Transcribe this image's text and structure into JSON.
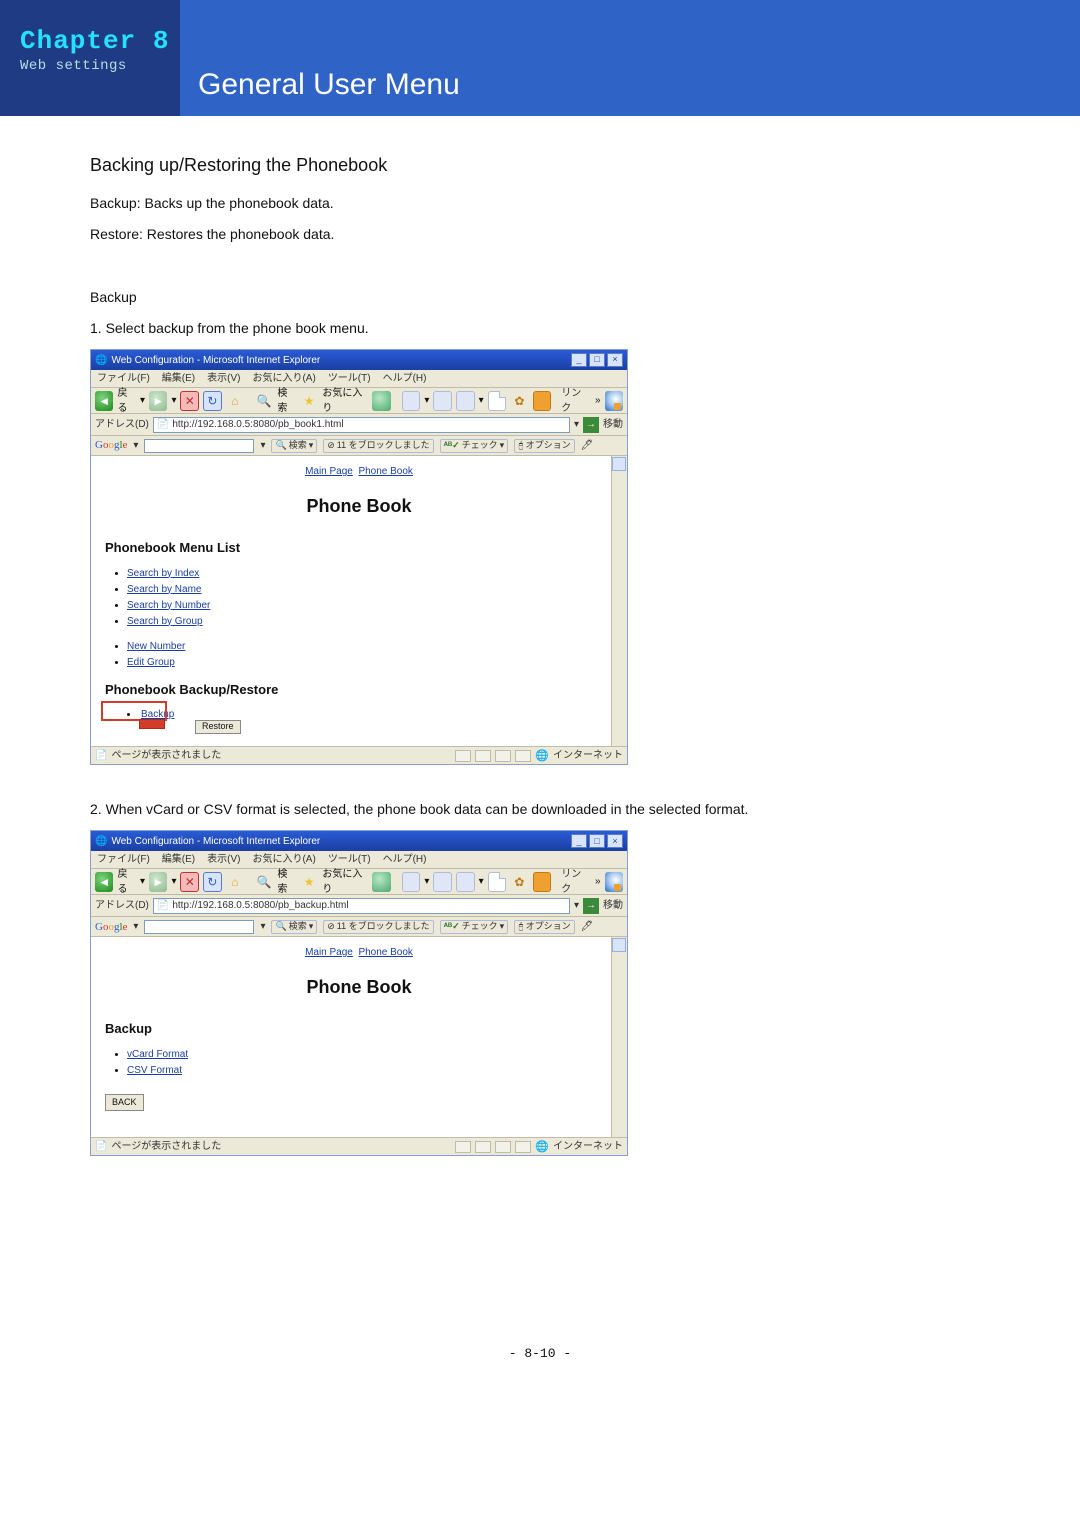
{
  "header": {
    "chapter": "Chapter 8",
    "subtitle": "Web settings",
    "title": "General User Menu"
  },
  "section": {
    "heading": "Backing up/Restoring the Phonebook",
    "line1": "Backup: Backs up the phonebook data.",
    "line2": "Restore: Restores the phonebook data."
  },
  "backup": {
    "label": "Backup",
    "step1": "1. Select backup from the phone book menu.",
    "step2": "2. When vCard or CSV format is selected, the phone book data can be downloaded in the selected format."
  },
  "ie": {
    "window_title": "Web Configuration - Microsoft Internet Explorer",
    "menus": [
      "ファイル(F)",
      "編集(E)",
      "表示(V)",
      "お気に入り(A)",
      "ツール(T)",
      "ヘルプ(H)"
    ],
    "toolbar": {
      "back": "戻る",
      "search": "検索",
      "favorites": "お気に入り",
      "links": "リンク"
    },
    "address_label": "アドレス(D)",
    "address1": "http://192.168.0.5:8080/pb_book1.html",
    "address2": "http://192.168.0.5:8080/pb_backup.html",
    "go": "移動",
    "googlebar": {
      "logo": "Google",
      "search_btn": "検索",
      "blocked": "11 をブロックしました",
      "check": "チェック",
      "options": "オプション"
    },
    "status_done": "ページが表示されました",
    "status_zone": "インターネット"
  },
  "page1": {
    "crumb_main": "Main Page",
    "crumb_phone": "Phone Book",
    "title": "Phone Book",
    "menu_list": "Phonebook Menu List",
    "items1": [
      "Search by Index",
      "Search by Name",
      "Search by Number",
      "Search by Group"
    ],
    "items2": [
      "New Number",
      "Edit Group"
    ],
    "backup_restore": "Phonebook Backup/Restore",
    "backup_link": "Backup",
    "restore_btn": "Restore"
  },
  "page2": {
    "crumb_main": "Main Page",
    "crumb_phone": "Phone Book",
    "title": "Phone Book",
    "backup_h": "Backup",
    "formats": [
      "vCard Format",
      "CSV Format"
    ],
    "back_btn": "BACK"
  },
  "pagenum": "- 8-10 -"
}
